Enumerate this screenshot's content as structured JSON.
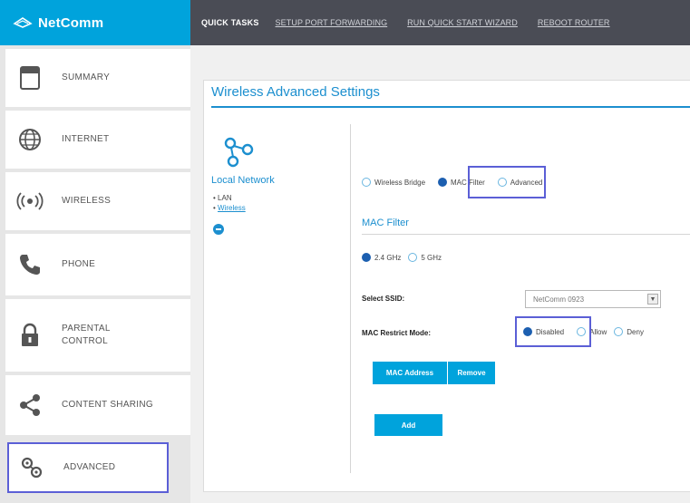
{
  "header": {
    "logo_text": "NetComm",
    "quick_tasks_label": "QUICK TASKS",
    "links": [
      "SETUP PORT FORWARDING",
      "RUN QUICK START WIZARD",
      "REBOOT ROUTER"
    ]
  },
  "sidebar": {
    "items": [
      {
        "label": "SUMMARY",
        "icon": "summary-icon"
      },
      {
        "label": "INTERNET",
        "icon": "globe-icon"
      },
      {
        "label": "WIRELESS",
        "icon": "wireless-icon"
      },
      {
        "label": "PHONE",
        "icon": "phone-icon"
      },
      {
        "label": "PARENTAL\nCONTROL",
        "icon": "lock-icon"
      },
      {
        "label": "CONTENT SHARING",
        "icon": "share-icon"
      },
      {
        "label": "ADVANCED",
        "icon": "gears-icon"
      }
    ],
    "active": "ADVANCED"
  },
  "panel": {
    "title": "Wireless Advanced Settings",
    "local_network": {
      "title": "Local Network",
      "items": [
        "LAN",
        "Wireless"
      ]
    },
    "mode_tabs": [
      {
        "label": "Wireless Bridge",
        "selected": false
      },
      {
        "label": "MAC Filter",
        "selected": true
      },
      {
        "label": "Advanced",
        "selected": false
      }
    ],
    "mac_filter": {
      "title": "MAC Filter",
      "bands": [
        {
          "label": "2.4 GHz",
          "selected": true
        },
        {
          "label": "5 GHz",
          "selected": false
        }
      ],
      "ssid_label": "Select SSID:",
      "ssid_value": "NetComm 0923",
      "restrict_label": "MAC Restrict Mode:",
      "restrict_options": [
        {
          "label": "Disabled",
          "selected": true
        },
        {
          "label": "Allow",
          "selected": false
        },
        {
          "label": "Deny",
          "selected": false
        }
      ],
      "table_headers": [
        "MAC Address",
        "Remove"
      ],
      "add_label": "Add"
    }
  },
  "colors": {
    "brand_blue": "#00a3dc",
    "nav_dark": "#4a4c55",
    "title_blue": "#1c8fcf",
    "highlight": "#5b5fd6"
  }
}
